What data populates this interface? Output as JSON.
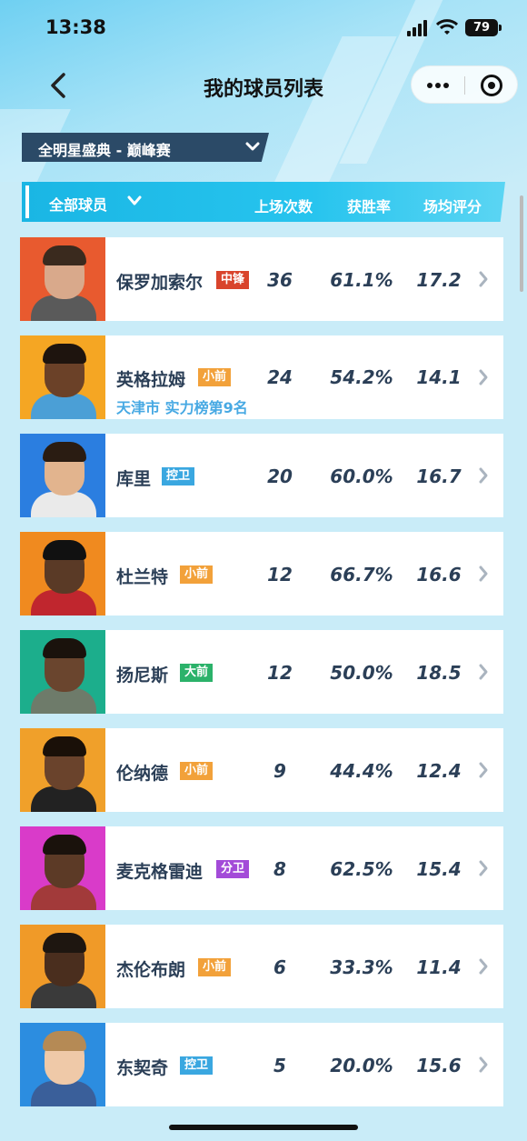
{
  "status_bar": {
    "time": "13:38",
    "battery": "79"
  },
  "nav": {
    "title": "我的球员列表"
  },
  "mode": {
    "label": "全明星盛典 - 巅峰赛"
  },
  "table_header": {
    "filter": "全部球员",
    "columns": [
      "上场次数",
      "获胜率",
      "场均评分"
    ]
  },
  "colors": {
    "accent": "#1ab6e4",
    "center": "#d9442c",
    "small_forward": "#f2a13a",
    "point_guard": "#3aa7e0",
    "power_forward": "#2bb26a",
    "shooting_guard": "#a34bd8"
  },
  "players": [
    {
      "name": "保罗加索尔",
      "position": "中锋",
      "games": "36",
      "win_rate": "61.1%",
      "rating": "17.2",
      "subline": ""
    },
    {
      "name": "英格拉姆",
      "position": "小前",
      "games": "24",
      "win_rate": "54.2%",
      "rating": "14.1",
      "subline": "天津市 实力榜第9名"
    },
    {
      "name": "库里",
      "position": "控卫",
      "games": "20",
      "win_rate": "60.0%",
      "rating": "16.7",
      "subline": ""
    },
    {
      "name": "杜兰特",
      "position": "小前",
      "games": "12",
      "win_rate": "66.7%",
      "rating": "16.6",
      "subline": ""
    },
    {
      "name": "扬尼斯",
      "position": "大前",
      "games": "12",
      "win_rate": "50.0%",
      "rating": "18.5",
      "subline": ""
    },
    {
      "name": "伦纳德",
      "position": "小前",
      "games": "9",
      "win_rate": "44.4%",
      "rating": "12.4",
      "subline": ""
    },
    {
      "name": "麦克格雷迪",
      "position": "分卫",
      "games": "8",
      "win_rate": "62.5%",
      "rating": "15.4",
      "subline": ""
    },
    {
      "name": "杰伦布朗",
      "position": "小前",
      "games": "6",
      "win_rate": "33.3%",
      "rating": "11.4",
      "subline": ""
    },
    {
      "name": "东契奇",
      "position": "控卫",
      "games": "5",
      "win_rate": "20.0%",
      "rating": "15.6",
      "subline": ""
    }
  ]
}
